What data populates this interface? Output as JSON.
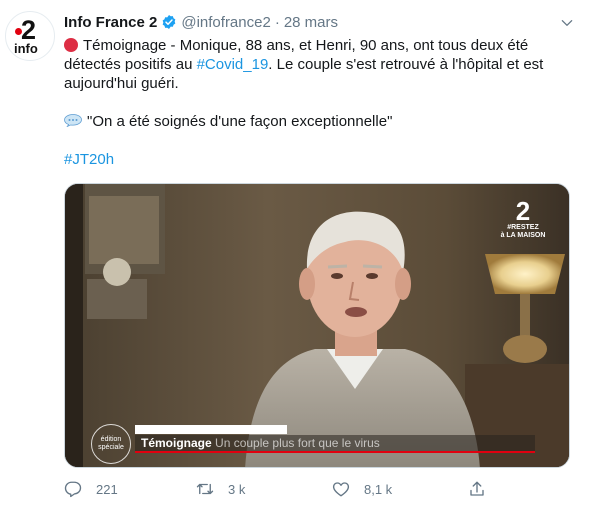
{
  "tweet": {
    "author_name": "Info France 2",
    "handle": "@infofrance2",
    "separator": "·",
    "date": "28 mars",
    "avatar": {
      "number": "2",
      "word": "info"
    },
    "text": {
      "line1": "Témoignage - Monique, 88 ans, et Henri, 90 ans, ont tous deux été",
      "line2_prefix": "détectés positifs au ",
      "hashtag_covid": "#Covid_19",
      "line2_suffix": ". Le couple s'est retrouvé à l'hôpital et est",
      "line3": "aujourd'hui guéri.",
      "quote": "\"On a été soignés d'une façon exceptionnelle\"",
      "hashtag_jt": "#JT20h"
    },
    "media": {
      "channel_number": "2",
      "channel_tag1": "#RESTEZ",
      "channel_tag2": "à LA MAISON",
      "edition_badge": "édition spéciale",
      "lower_third_title": "Témoignage",
      "lower_third_subtitle": "Un couple plus fort que le virus"
    },
    "actions": {
      "reply_count": "221",
      "retweet_count": "3 k",
      "like_count": "8,1 k"
    }
  },
  "colors": {
    "link": "#1b95e0",
    "muted": "#657786",
    "verified": "#1da1f2",
    "red_circle": "#dd2e44",
    "brand_red": "#e1000f"
  },
  "icons": [
    "verified-badge-icon",
    "chevron-down-icon",
    "red-circle-emoji-icon",
    "speech-bubble-emoji-icon",
    "reply-icon",
    "retweet-icon",
    "like-icon",
    "share-icon"
  ]
}
